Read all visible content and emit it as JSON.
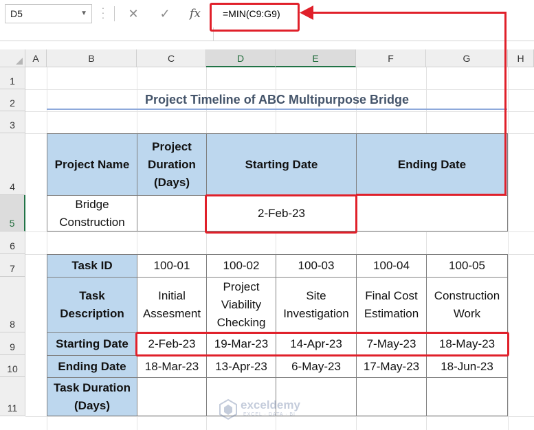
{
  "namebox": {
    "value": "D5"
  },
  "formula_bar": {
    "fx_label": "fx",
    "formula": "=MIN(C9:G9)"
  },
  "columns": [
    "A",
    "B",
    "C",
    "D",
    "E",
    "F",
    "G",
    "H"
  ],
  "rows": [
    "1",
    "2",
    "3",
    "4",
    "5",
    "6",
    "7",
    "8",
    "9",
    "10",
    "11"
  ],
  "sheet": {
    "title": "Project Timeline of ABC Multipurpose Bridge",
    "project_header": {
      "name": "Project Name",
      "duration": "Project Duration (Days)",
      "start": "Starting Date",
      "end": "Ending Date"
    },
    "project_row": {
      "name": "Bridge Construction",
      "duration": "",
      "start": "2-Feb-23",
      "end": ""
    },
    "tasks": {
      "id_label": "Task ID",
      "desc_label": "Task Description",
      "start_label": "Starting Date",
      "end_label": "Ending Date",
      "duration_label": "Task Duration (Days)",
      "ids": [
        "100-01",
        "100-02",
        "100-03",
        "100-04",
        "100-05"
      ],
      "descriptions": [
        "Initial Assesment",
        "Project Viability Checking",
        "Site Investigation",
        "Final Cost Estimation",
        "Construction Work"
      ],
      "start_dates": [
        "2-Feb-23",
        "19-Mar-23",
        "14-Apr-23",
        "7-May-23",
        "18-May-23"
      ],
      "end_dates": [
        "18-Mar-23",
        "13-Apr-23",
        "6-May-23",
        "17-May-23",
        "18-Jun-23"
      ]
    }
  },
  "watermark": {
    "brand": "exceldemy",
    "tagline": "EXCEL · DATA · BI"
  },
  "colors": {
    "header_fill": "#bdd7ee",
    "highlight": "#e0202a",
    "selected": "#217346"
  }
}
